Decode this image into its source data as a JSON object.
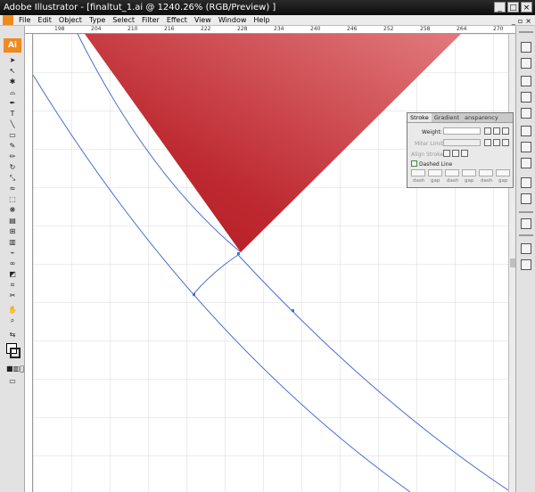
{
  "window": {
    "title": "Adobe Illustrator - [finaltut_1.ai @ 1240.26% (RGB/Preview) ]"
  },
  "menubar": {
    "items": [
      "File",
      "Edit",
      "Object",
      "Type",
      "Select",
      "Filter",
      "Effect",
      "View",
      "Window",
      "Help"
    ]
  },
  "toolbar": {
    "logo_text": "Ai"
  },
  "ruler": {
    "labels": [
      "198",
      "204",
      "210",
      "216",
      "222",
      "228",
      "234",
      "240",
      "246",
      "252",
      "258",
      "264",
      "270"
    ]
  },
  "stroke_panel": {
    "tabs": [
      "Stroke",
      "Gradient",
      "ansparency"
    ],
    "weight_label": "Weight:",
    "miter_label": "Miter Limit:",
    "align_label": "Align Stroke:",
    "dashed_label": "Dashed Line",
    "dash_labels": [
      "dash",
      "gap",
      "dash",
      "gap",
      "dash",
      "gap"
    ]
  },
  "colors": {
    "triangle_dark": "#b2161f",
    "triangle_light": "#e17a7d",
    "path_blue": "#4a6fd0",
    "accent_orange": "#f08a1e"
  }
}
